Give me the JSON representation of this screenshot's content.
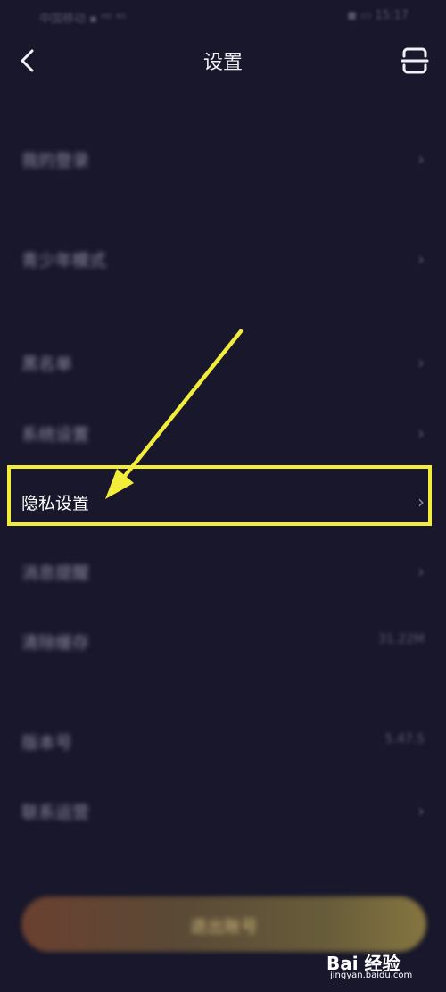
{
  "status_bar": {
    "left": "中国移动 ▪ ᴴᴰ ⁴ᴳ",
    "right": "◼ ▭ 15:17"
  },
  "header": {
    "title": "设置",
    "back_icon": "chevron-left-icon",
    "action_icon": "scan-icon"
  },
  "settings": {
    "items": [
      {
        "label": "我的登录",
        "value": ""
      },
      {
        "label": "青少年模式",
        "value": ""
      },
      {
        "label": "黑名单",
        "value": ""
      },
      {
        "label": "系统设置",
        "value": ""
      },
      {
        "label": "隐私设置",
        "value": ""
      },
      {
        "label": "消息提醒",
        "value": ""
      },
      {
        "label": "清除缓存",
        "value": "31.22M"
      },
      {
        "label": "版本号",
        "value": "5.47.5"
      },
      {
        "label": "联系运营",
        "value": ""
      }
    ],
    "chevron": "›"
  },
  "logout": {
    "label": "退出账号"
  },
  "colors": {
    "highlight": "#f2ec3a",
    "background": "#18172b"
  },
  "watermark": {
    "main": "Bai 经验",
    "sub": "jingyan.baidu.com"
  }
}
